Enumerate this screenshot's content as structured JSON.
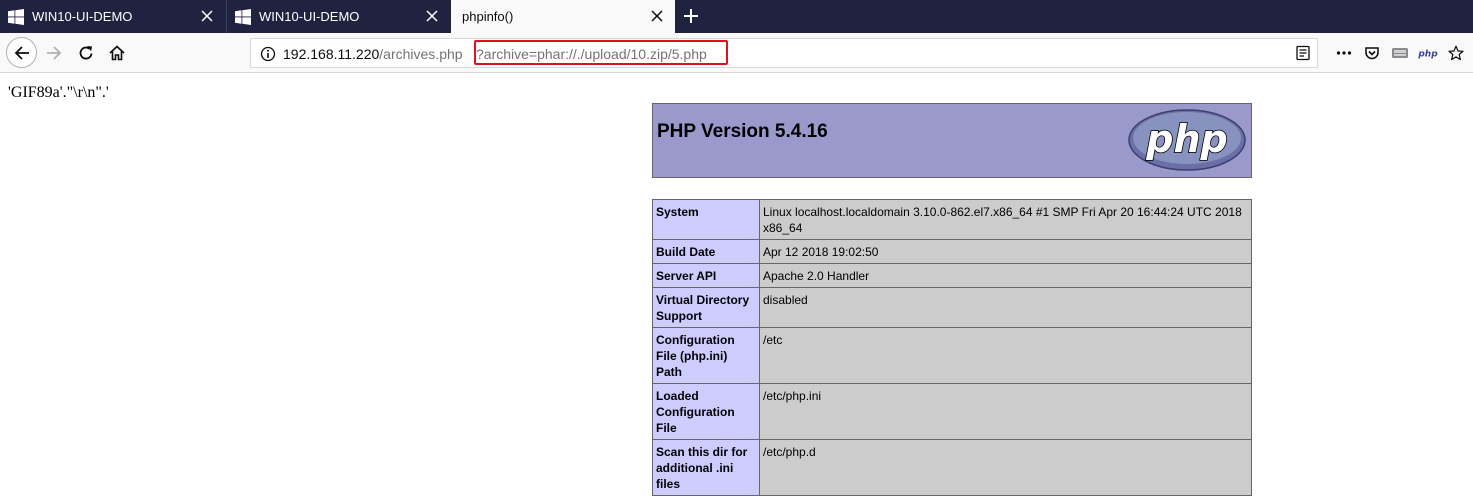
{
  "tabs": [
    {
      "title": "WIN10-UI-DEMO",
      "active": false
    },
    {
      "title": "WIN10-UI-DEMO",
      "active": false
    },
    {
      "title": "phpinfo()",
      "active": true
    }
  ],
  "navbar": {
    "url_host": "192.168.11.220",
    "url_path": "/archives.php",
    "url_query": "?archive=phar://./upload/10.zip/5.php"
  },
  "page": {
    "output_text": "'GIF89a'.\"\\r\\n\".'",
    "php_version": "PHP Version 5.4.16",
    "logo_text": "php",
    "info_rows": [
      {
        "key": "System",
        "value": "Linux localhost.localdomain 3.10.0-862.el7.x86_64 #1 SMP Fri Apr 20 16:44:24 UTC 2018 x86_64"
      },
      {
        "key": "Build Date",
        "value": "Apr 12 2018 19:02:50"
      },
      {
        "key": "Server API",
        "value": "Apache 2.0 Handler"
      },
      {
        "key": "Virtual Directory Support",
        "value": "disabled"
      },
      {
        "key": "Configuration File (php.ini) Path",
        "value": "/etc"
      },
      {
        "key": "Loaded Configuration File",
        "value": "/etc/php.ini"
      },
      {
        "key": "Scan this dir for additional .ini files",
        "value": "/etc/php.d"
      }
    ]
  },
  "colors": {
    "tabstrip_bg": "#202340",
    "php_header_bg": "#9999cc",
    "key_cell_bg": "#ccccff",
    "value_cell_bg": "#cccccc",
    "highlight_border": "#e0111a"
  },
  "icons": {
    "toolbar_right": [
      "reader-view-icon",
      "page-actions-icon",
      "pocket-icon",
      "extension-icon",
      "php-extension-icon",
      "bookmark-star-icon"
    ]
  }
}
